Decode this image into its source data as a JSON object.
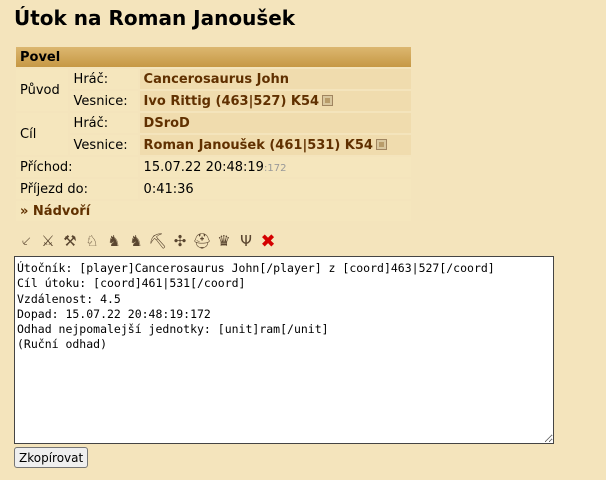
{
  "title": "Útok na Roman Janoušek",
  "table": {
    "header": "Povel",
    "origin_label": "Původ",
    "target_label": "Cíl",
    "player_label": "Hráč:",
    "village_label": "Vesnice:",
    "origin_player": "Cancerosaurus John",
    "origin_village": "Ivo Rittig (463|527) K54",
    "target_player": "DSroD",
    "target_village": "Roman Janoušek (461|531) K54",
    "arrival_label": "Příchod:",
    "arrival_value": "15.07.22 20:48:19",
    "arrival_ms": ":172",
    "arrive_in_label": "Příjezd do:",
    "arrive_in_value": "0:41:36",
    "courtyard_link": "» Nádvoří"
  },
  "unit_icons": [
    {
      "name": "spear-icon",
      "glyph": "⸔"
    },
    {
      "name": "sword-icon",
      "glyph": "⚔"
    },
    {
      "name": "axe-icon",
      "glyph": "⚒"
    },
    {
      "name": "scout-icon",
      "glyph": "♘"
    },
    {
      "name": "light-cavalry-icon",
      "glyph": "♞"
    },
    {
      "name": "heavy-cavalry-icon",
      "glyph": "♞"
    },
    {
      "name": "ram-icon",
      "glyph": "⛏"
    },
    {
      "name": "catapult-icon",
      "glyph": "✣"
    },
    {
      "name": "knight-icon",
      "glyph": "⛑"
    },
    {
      "name": "noble-icon",
      "glyph": "♛"
    },
    {
      "name": "pitchfork-icon",
      "glyph": "Ψ"
    },
    {
      "name": "close-icon",
      "glyph": "✖"
    }
  ],
  "textarea_value": "Útočník: [player]Cancerosaurus John[/player] z [coord]463|527[/coord]\nCíl útoku: [coord]461|531[/coord]\nVzdálenost: 4.5\nDopad: 15.07.22 20:48:19:172\nOdhad nejpomalejší jednotky: [unit]ram[/unit]\n(Ruční odhad)",
  "copy_button": "Zkopírovat"
}
